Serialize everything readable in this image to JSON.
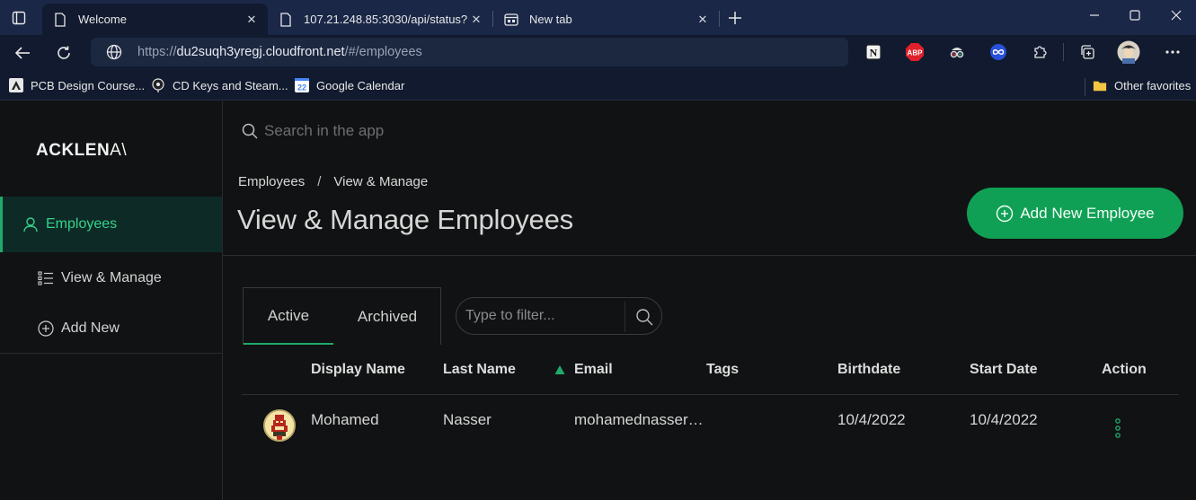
{
  "browser": {
    "tabs": [
      {
        "title": "Welcome",
        "icon": "page-icon",
        "active": true
      },
      {
        "title": "107.21.248.85:3030/api/status?",
        "icon": "page-icon",
        "active": false
      },
      {
        "title": "New tab",
        "icon": "new-tab-page-icon",
        "active": false
      }
    ],
    "address": {
      "scheme": "https://",
      "host": "du2suqh3yregj.cloudfront.net",
      "path": "/#/employees"
    },
    "extensions": [
      "notion-icon",
      "adblock-plus-icon",
      "spy-icon",
      "infinity-icon",
      "extensions-puzzle-icon",
      "collections-icon",
      "profile-avatar-icon",
      "more-icon"
    ],
    "favorites": [
      {
        "label": "PCB Design Course...",
        "icon": "altium-icon"
      },
      {
        "label": "CD Keys and Steam...",
        "icon": "keys-icon"
      },
      {
        "label": "Google Calendar",
        "icon": "calendar-icon",
        "icon_text": "22"
      }
    ],
    "other_favorites": "Other favorites"
  },
  "app": {
    "logo": {
      "bold": "ACKLEN",
      "thin": "A\\"
    },
    "nav": {
      "employees": "Employees",
      "view_manage": "View & Manage",
      "add_new": "Add New"
    },
    "search_placeholder": "Search in the app",
    "breadcrumb": {
      "root": "Employees",
      "sep": "/",
      "current": "View & Manage"
    },
    "page_title": "View & Manage Employees",
    "add_button": "Add New Employee",
    "status_tabs": {
      "active": "Active",
      "archived": "Archived"
    },
    "filter_placeholder": "Type to filter...",
    "table": {
      "headers": {
        "display_name": "Display Name",
        "last_name": "Last Name",
        "email": "Email",
        "tags": "Tags",
        "birthdate": "Birthdate",
        "start_date": "Start Date",
        "action": "Action"
      },
      "sorted_by": "email",
      "rows": [
        {
          "display_name": "Mohamed",
          "last_name": "Nasser",
          "email": "mohamednasser…",
          "tags": "",
          "birthdate": "10/4/2022",
          "start_date": "10/4/2022"
        }
      ]
    }
  },
  "colors": {
    "accent": "#10a055",
    "accent_text": "#35d38a",
    "background": "#111213",
    "browser_frame": "#1a2747"
  }
}
